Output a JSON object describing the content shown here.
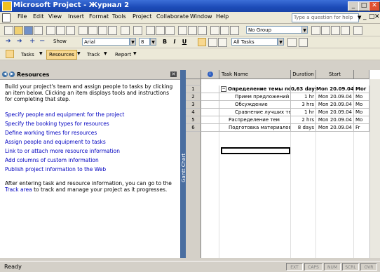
{
  "window": {
    "title": "Microsoft Project - Журнал 2",
    "min_glyph": "_",
    "max_glyph": "□",
    "close_glyph": "✕"
  },
  "menu": {
    "items": [
      "File",
      "Edit",
      "View",
      "Insert",
      "Format",
      "Tools",
      "Project",
      "Collaborate",
      "Window",
      "Help"
    ],
    "help_placeholder": "Type a question for help",
    "help_arrow": "▼",
    "doc_min": "_",
    "doc_max": "□",
    "doc_close": "✕"
  },
  "standard_toolbar": {
    "group_value": "No Group",
    "dropdown_glyph": "▼"
  },
  "formatting_toolbar": {
    "show_label": "Show",
    "font": "Arial",
    "size": "8",
    "bold": "B",
    "italic": "I",
    "underline": "U",
    "filter": "All Tasks",
    "arrows": [
      "➔",
      "➔",
      "+",
      "−"
    ]
  },
  "guide_toolbar": {
    "buttons": [
      "Tasks",
      "Resources",
      "Track",
      "Report"
    ],
    "active": "Resources",
    "dropdown_glyph": "▼"
  },
  "side_pane": {
    "back_glyph": "◀",
    "forward_glyph": "▶",
    "title": "Resources",
    "close_glyph": "✕",
    "intro": "Build your project's team and assign people to tasks by clicking an item below. Clicking an item displays tools and instructions for completing that step.",
    "links": [
      "Specify people and equipment for the project",
      "Specify the booking types for resources",
      "Define working times for resources",
      "Assign people and equipment to tasks",
      "Link to or attach more resource information",
      "Add columns of custom information",
      "Publish project information to the Web"
    ],
    "outro_before": "After entering task and resource information, you can go to the ",
    "outro_link": "Track area",
    "outro_after": " to track and manage your project as it progresses."
  },
  "gantt_label": "Gantt Chart",
  "table": {
    "info_glyph": "i",
    "headers": {
      "task_name": "Task Name",
      "duration": "Duration",
      "start": "Start"
    },
    "rows": [
      {
        "id": "1",
        "name": "Определение темы по",
        "duration": "0,63 days",
        "start": "Mon 20.09.04",
        "extra": "Mor",
        "summary": true
      },
      {
        "id": "2",
        "name": "Прием предложений",
        "duration": "1 hr",
        "start": "Mon 20.09.04",
        "extra": "Mo",
        "summary": false
      },
      {
        "id": "3",
        "name": "Обсуждение",
        "duration": "3 hrs",
        "start": "Mon 20.09.04",
        "extra": "Mo",
        "summary": false
      },
      {
        "id": "4",
        "name": "Сравнение лучших те",
        "duration": "1 hr",
        "start": "Mon 20.09.04",
        "extra": "Mo",
        "summary": false
      },
      {
        "id": "5",
        "name": "Распределение тем",
        "duration": "2 hrs",
        "start": "Mon 20.09.04",
        "extra": "Mo",
        "summary": false
      },
      {
        "id": "6",
        "name": "Подготовка материалов",
        "duration": "8 days",
        "start": "Mon 20.09.04",
        "extra": "Fr",
        "summary": false
      }
    ],
    "collapse_glyph": "−"
  },
  "status": {
    "text": "Ready",
    "indicators": [
      "EXT",
      "CAPS",
      "NUM",
      "SCRL",
      "OVR"
    ]
  }
}
